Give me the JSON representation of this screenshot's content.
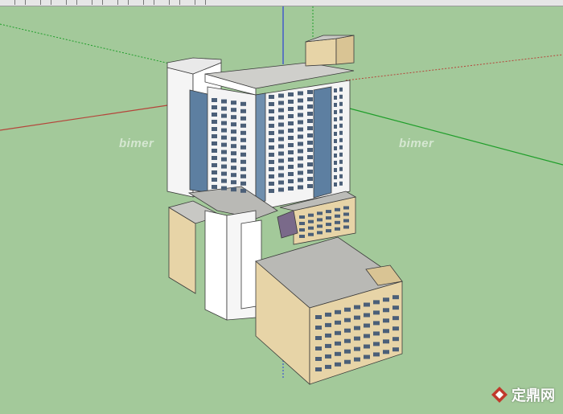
{
  "app": {
    "canvas_background": "#a3c99a"
  },
  "axes": {
    "red": "#b5443a",
    "green": "#1f9e2a",
    "blue": "#2e3fd6"
  },
  "building": {
    "wall_tan": "#e7d4a7",
    "wall_white": "#ffffff",
    "roof_gray": "#b9b9b5",
    "glass_blue": "#5d7fa1"
  },
  "watermarks": {
    "left_text": "bimer",
    "right_text": "bimer",
    "corner_text": "定鼎网"
  }
}
